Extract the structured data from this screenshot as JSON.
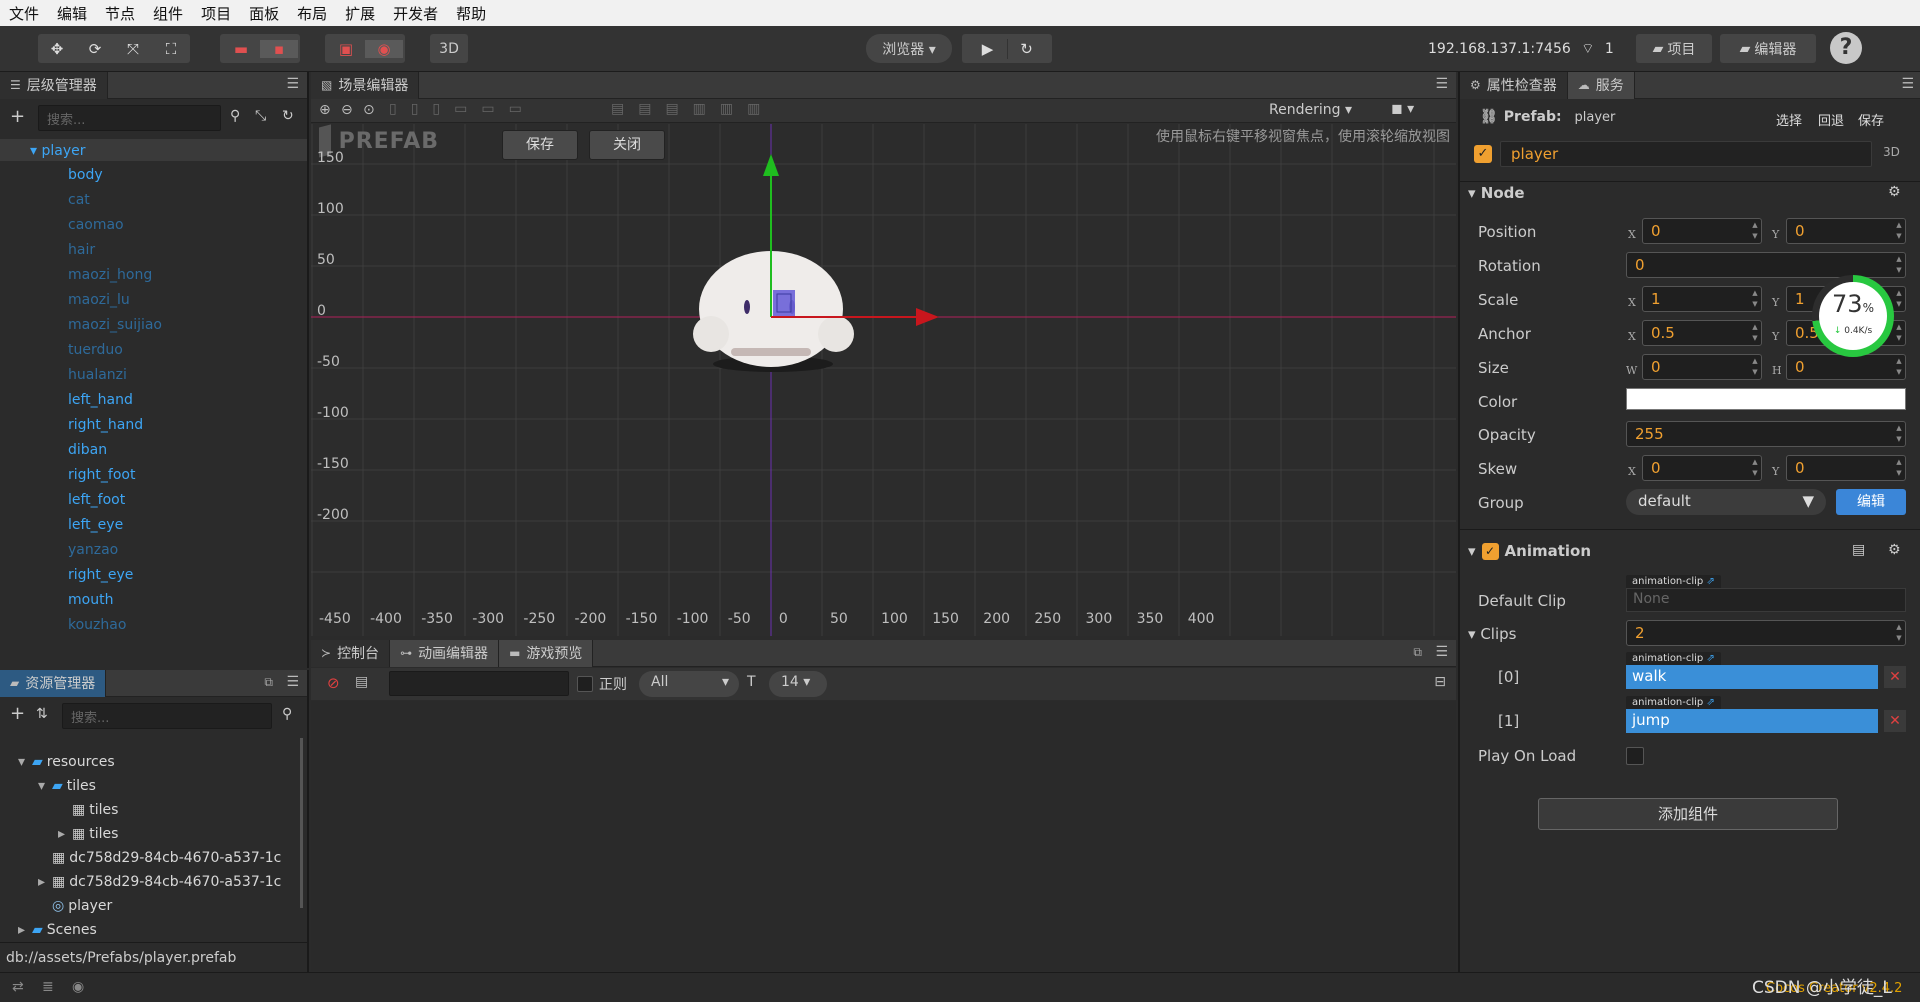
{
  "menu": [
    "文件",
    "编辑",
    "节点",
    "组件",
    "项目",
    "面板",
    "布局",
    "扩展",
    "开发者",
    "帮助"
  ],
  "toolbar": {
    "mode_3d": "3D",
    "browser_select": "浏览器 ▾",
    "ip": "192.168.137.1:7456",
    "device_count": "1",
    "project_btn": "项目",
    "editor_btn": "编辑器"
  },
  "hierarchy": {
    "tab": "层级管理器",
    "search_placeholder": "搜索...",
    "root": "player",
    "items": [
      {
        "label": "body",
        "active": true
      },
      {
        "label": "cat",
        "active": false
      },
      {
        "label": "caomao",
        "active": false
      },
      {
        "label": "hair",
        "active": false
      },
      {
        "label": "maozi_hong",
        "active": false
      },
      {
        "label": "maozi_lu",
        "active": false
      },
      {
        "label": "maozi_suijiao",
        "active": false
      },
      {
        "label": "tuerduo",
        "active": false
      },
      {
        "label": "hualanzi",
        "active": false
      },
      {
        "label": "left_hand",
        "active": true
      },
      {
        "label": "right_hand",
        "active": true
      },
      {
        "label": "diban",
        "active": true
      },
      {
        "label": "right_foot",
        "active": true
      },
      {
        "label": "left_foot",
        "active": true
      },
      {
        "label": "left_eye",
        "active": true
      },
      {
        "label": "yanzao",
        "active": false
      },
      {
        "label": "right_eye",
        "active": true
      },
      {
        "label": "mouth",
        "active": true
      },
      {
        "label": "kouzhao",
        "active": false
      }
    ]
  },
  "assets": {
    "tab": "资源管理器",
    "search_placeholder": "搜索...",
    "items": [
      {
        "label": "resources",
        "level": 2
      },
      {
        "label": "tiles",
        "level": 3
      },
      {
        "label": "tiles",
        "level": 4
      },
      {
        "label": "tiles",
        "level": 4
      },
      {
        "label": "dc758d29-84cb-4670-a537-1c",
        "level": 3
      },
      {
        "label": "dc758d29-84cb-4670-a537-1c",
        "level": 3
      },
      {
        "label": "player",
        "level": 3
      },
      {
        "label": "Scenes",
        "level": 2
      }
    ],
    "path": "db://assets/Prefabs/player.prefab"
  },
  "scene": {
    "tab": "场景编辑器",
    "rendering": "Rendering",
    "prefab_label": "PREFAB",
    "save_btn": "保存",
    "close_btn": "关闭",
    "hint": "使用鼠标右键平移视窗焦点，使用滚轮缩放视图",
    "y_labels": [
      "150",
      "100",
      "50",
      "0",
      "-50",
      "-100",
      "-150",
      "-200"
    ],
    "x_labels": [
      "-450",
      "-400",
      "-350",
      "-300",
      "-250",
      "-200",
      "-150",
      "-100",
      "-50",
      "0",
      "50",
      "100",
      "150",
      "200",
      "250",
      "300",
      "350",
      "400"
    ]
  },
  "console": {
    "tabs": [
      "控制台",
      "动画编辑器",
      "游戏预览"
    ],
    "regex_label": "正则",
    "level_select": "All",
    "font_size": "14"
  },
  "inspector": {
    "tabs": [
      "属性检查器",
      "服务"
    ],
    "prefab_label": "Prefab:",
    "prefab_name": "player",
    "actions": [
      "选择",
      "回退",
      "保存"
    ],
    "node_name": "player",
    "badge_3d": "3D",
    "node_section": "Node",
    "position": {
      "label": "Position",
      "x": "0",
      "y": "0"
    },
    "rotation": {
      "label": "Rotation",
      "value": "0"
    },
    "scale": {
      "label": "Scale",
      "x": "1",
      "y": "1"
    },
    "anchor": {
      "label": "Anchor",
      "x": "0.5",
      "y": "0.5"
    },
    "size": {
      "label": "Size",
      "w": "0",
      "h": "0"
    },
    "color": {
      "label": "Color",
      "value": "#ffffff"
    },
    "opacity": {
      "label": "Opacity",
      "value": "255"
    },
    "skew": {
      "label": "Skew",
      "x": "0",
      "y": "0"
    },
    "group": {
      "label": "Group",
      "value": "default",
      "edit_btn": "编辑"
    },
    "animation_section": "Animation",
    "default_clip": {
      "label": "Default Clip",
      "tag": "animation-clip",
      "value": "None"
    },
    "clips": {
      "label": "Clips",
      "count": "2"
    },
    "clip_items": [
      {
        "index": "[0]",
        "tag": "animation-clip",
        "value": "walk"
      },
      {
        "index": "[1]",
        "tag": "animation-clip",
        "value": "jump"
      }
    ],
    "play_on_load": "Play On Load",
    "add_component": "添加组件",
    "perf": {
      "percent": "73",
      "unit": "%",
      "speed": "0.4K/s"
    }
  },
  "status": {
    "watermark": "CSDN @小学徒_L",
    "version": "Cocos Creator v2.4.2"
  },
  "colors": {
    "accent": "#3da5f4",
    "value_orange": "#f0a030",
    "axis_red": "#c8161d",
    "axis_green": "#1fbe1f",
    "edit_btn": "#3b86d8"
  }
}
